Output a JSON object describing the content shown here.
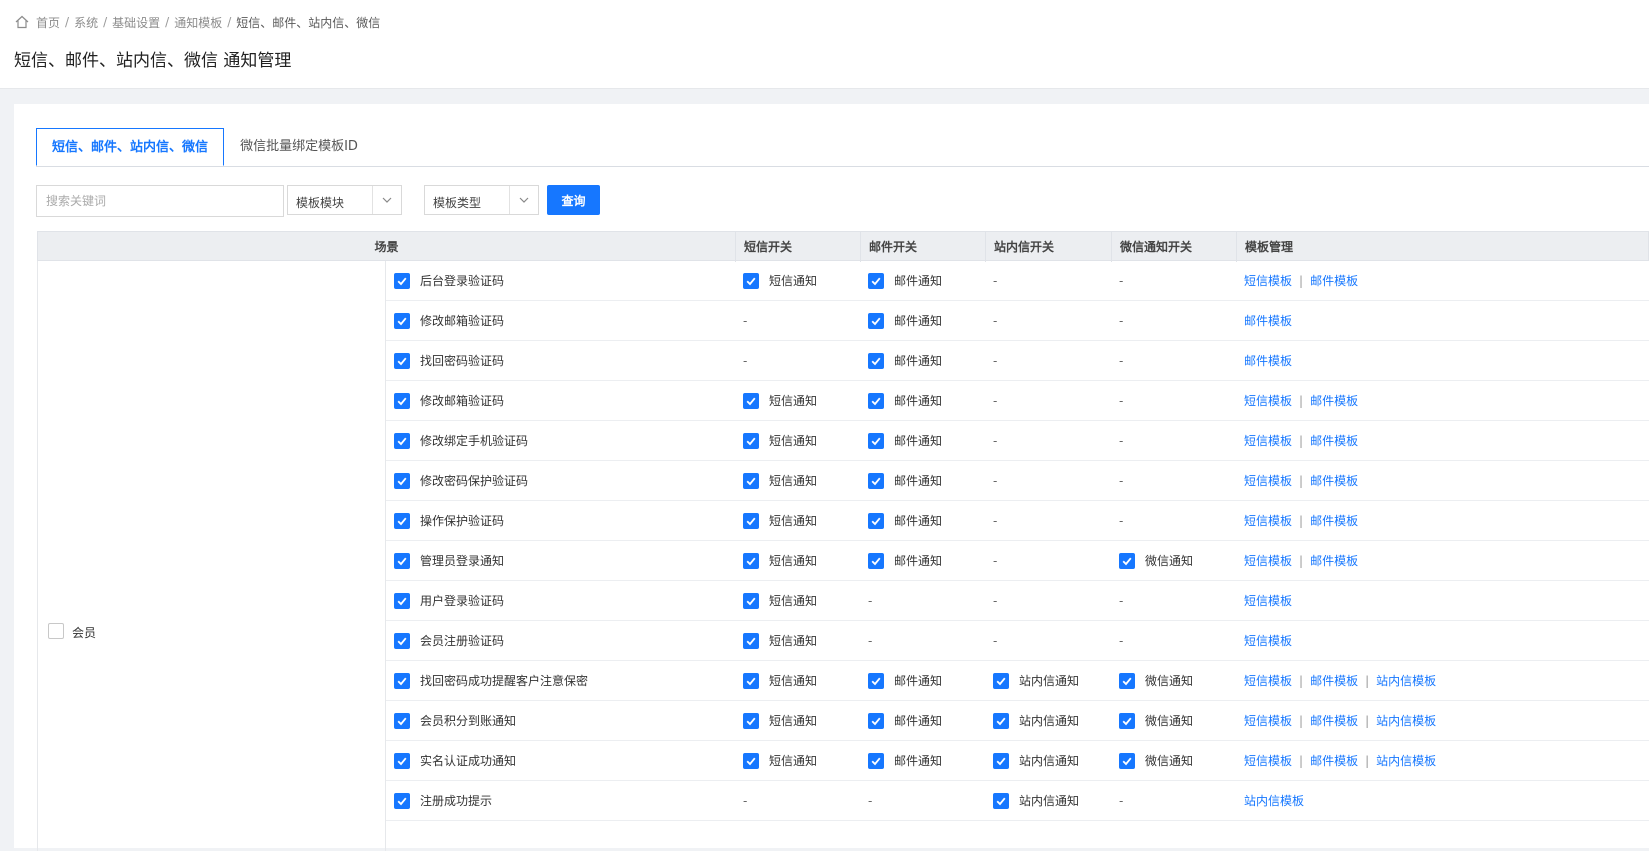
{
  "breadcrumb": {
    "items": [
      "首页",
      "系统",
      "基础设置",
      "通知模板",
      "短信、邮件、站内信、微信"
    ],
    "separator": "/"
  },
  "page_title": "短信、邮件、站内信、微信 通知管理",
  "tabs": [
    {
      "label": "短信、邮件、站内信、微信",
      "active": true
    },
    {
      "label": "微信批量绑定模板ID",
      "active": false
    }
  ],
  "filters": {
    "search_placeholder": "搜索关键词",
    "module_select": "模板模块",
    "type_select": "模板类型",
    "query_button": "查询"
  },
  "table": {
    "headers": {
      "scene": "场景",
      "sms": "短信开关",
      "mail": "邮件开关",
      "site": "站内信开关",
      "wx": "微信通知开关",
      "tpl": "模板管理"
    },
    "group_label": "会员",
    "dash": "-",
    "labels": {
      "sms": "短信通知",
      "mail": "邮件通知",
      "site": "站内信通知",
      "wx": "微信通知"
    },
    "links": {
      "sms": "短信模板",
      "mail": "邮件模板",
      "site": "站内信模板"
    },
    "rows": [
      {
        "name": "后台登录验证码",
        "sms": true,
        "mail": true,
        "site": false,
        "wx": false
      },
      {
        "name": "修改邮箱验证码",
        "sms": false,
        "mail": true,
        "site": false,
        "wx": false
      },
      {
        "name": "找回密码验证码",
        "sms": false,
        "mail": true,
        "site": false,
        "wx": false
      },
      {
        "name": "修改邮箱验证码",
        "sms": true,
        "mail": true,
        "site": false,
        "wx": false
      },
      {
        "name": "修改绑定手机验证码",
        "sms": true,
        "mail": true,
        "site": false,
        "wx": false
      },
      {
        "name": "修改密码保护验证码",
        "sms": true,
        "mail": true,
        "site": false,
        "wx": false
      },
      {
        "name": "操作保护验证码",
        "sms": true,
        "mail": true,
        "site": false,
        "wx": false
      },
      {
        "name": "管理员登录通知",
        "sms": true,
        "mail": true,
        "site": false,
        "wx": true
      },
      {
        "name": "用户登录验证码",
        "sms": true,
        "mail": false,
        "site": false,
        "wx": false
      },
      {
        "name": "会员注册验证码",
        "sms": true,
        "mail": false,
        "site": false,
        "wx": false
      },
      {
        "name": "找回密码成功提醒客户注意保密",
        "sms": true,
        "mail": true,
        "site": true,
        "wx": true
      },
      {
        "name": "会员积分到账通知",
        "sms": true,
        "mail": true,
        "site": true,
        "wx": true
      },
      {
        "name": "实名认证成功通知",
        "sms": true,
        "mail": true,
        "site": true,
        "wx": true
      },
      {
        "name": "注册成功提示",
        "sms": false,
        "mail": false,
        "site": true,
        "wx": false
      }
    ]
  }
}
